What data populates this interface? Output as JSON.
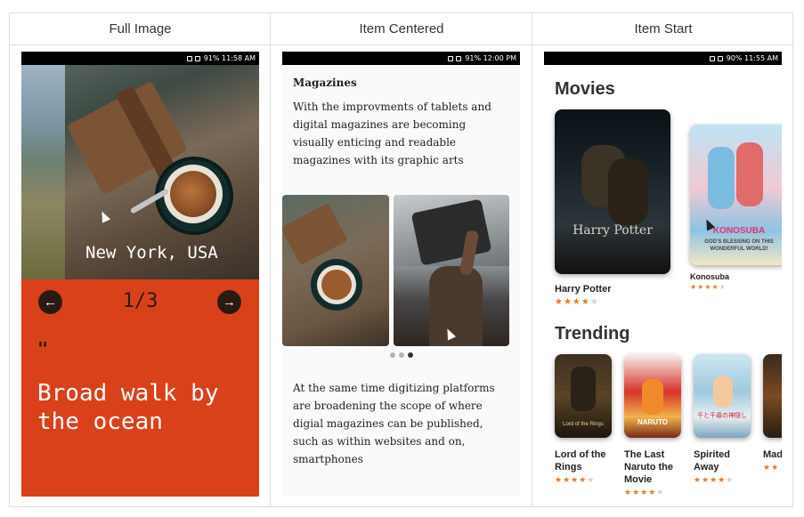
{
  "headers": {
    "col1": "Full Image",
    "col2": "Item Centered",
    "col3": "Item Start"
  },
  "phone1": {
    "status": "91% 11:58 AM",
    "city": "New York, USA",
    "counter": "1/3",
    "quote_mark": "\"",
    "caption": "Broad walk by the ocean",
    "prev_icon": "arrow-left-icon",
    "next_icon": "arrow-right-icon",
    "accent": "#d9411b"
  },
  "phone2": {
    "status": "91% 12:00 PM",
    "title": "Magazines",
    "body1": "With the improvments of tablets and digital magazines are becoming visually enticing and readable magazines with its graphic arts",
    "body2": "At the same time digitizing platforms are broadening the scope of where digial magazines can be published, such as within websites and on, smartphones",
    "dots": 3,
    "active_dot": 3
  },
  "phone3": {
    "status": "90% 11:55 AM",
    "section_movies": "Movies",
    "section_trending": "Trending",
    "movies": [
      {
        "title": "Harry Potter",
        "rating": 4
      },
      {
        "title": "Konosuba",
        "rating": 4
      }
    ],
    "trending": [
      {
        "title": "Lord of the Rings",
        "rating": 4
      },
      {
        "title": "The Last Naruto the Movie",
        "rating": 4
      },
      {
        "title": "Spirited Away",
        "rating": 4
      },
      {
        "title": "Mad",
        "rating": 2
      }
    ],
    "poster_text": {
      "harry_potter": "Harry Potter",
      "konosuba": "KONOSUBA",
      "konosuba_sub": "GOD'S BLESSING ON THIS WONDERFUL WORLD!",
      "lotr": "Lord of the Rings",
      "naruto": "NARUTO",
      "spirited": "千と千尋の神隠し"
    }
  }
}
